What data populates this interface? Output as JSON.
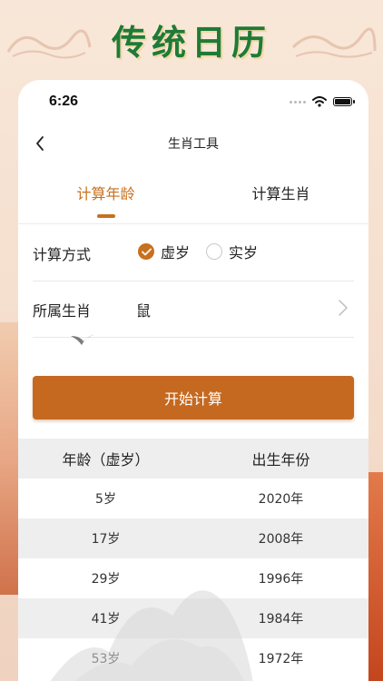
{
  "banner": {
    "title": "传统日历"
  },
  "status_bar": {
    "time": "6:26"
  },
  "navbar": {
    "title": "生肖工具"
  },
  "tabs": [
    {
      "label": "计算年龄",
      "active": true
    },
    {
      "label": "计算生肖",
      "active": false
    }
  ],
  "form": {
    "method_label": "计算方式",
    "options": [
      {
        "label": "虚岁",
        "selected": true
      },
      {
        "label": "实岁",
        "selected": false
      }
    ],
    "zodiac_label": "所属生肖",
    "zodiac_value": "鼠"
  },
  "start_button": {
    "label": "开始计算"
  },
  "table": {
    "headers": [
      "年龄（虚岁）",
      "出生年份"
    ],
    "rows": [
      [
        "5岁",
        "2020年"
      ],
      [
        "17岁",
        "2008年"
      ],
      [
        "29岁",
        "1996年"
      ],
      [
        "41岁",
        "1984年"
      ],
      [
        "53岁",
        "1972年"
      ]
    ]
  },
  "colors": {
    "accent": "#c7701d",
    "button": "#c4691f",
    "banner_title": "#1f7a3a"
  }
}
